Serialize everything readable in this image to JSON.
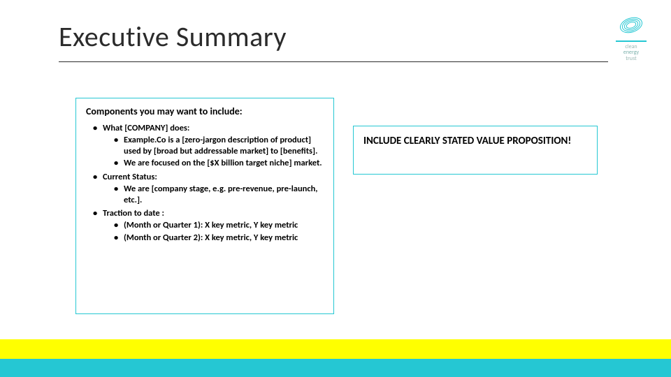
{
  "title": "Executive Summary",
  "logo": {
    "line1": "clean",
    "line2": "energy",
    "line3": "trust"
  },
  "left_box": {
    "heading": "Components you may want to include:",
    "sections": [
      {
        "label": "What [COMPANY] does:",
        "items": [
          "Example.Co is a [zero-jargon description of product] used by [broad but addressable market] to [benefits].",
          "We are focused on the [$X billion target niche] market."
        ]
      },
      {
        "label": "Current Status:",
        "items": [
          "We are [company stage, e.g. pre-revenue, pre-launch, etc.]."
        ]
      },
      {
        "label": "Traction to date :",
        "items": [
          "(Month or Quarter 1): X key metric, Y key metric",
          "(Month or Quarter 2): X key metric, Y key metric"
        ]
      }
    ]
  },
  "right_box": {
    "callout": "INCLUDE CLEARLY STATED VALUE PROPOSITION!"
  },
  "colors": {
    "accent": "#25c7d3",
    "highlight": "#ffff00"
  }
}
